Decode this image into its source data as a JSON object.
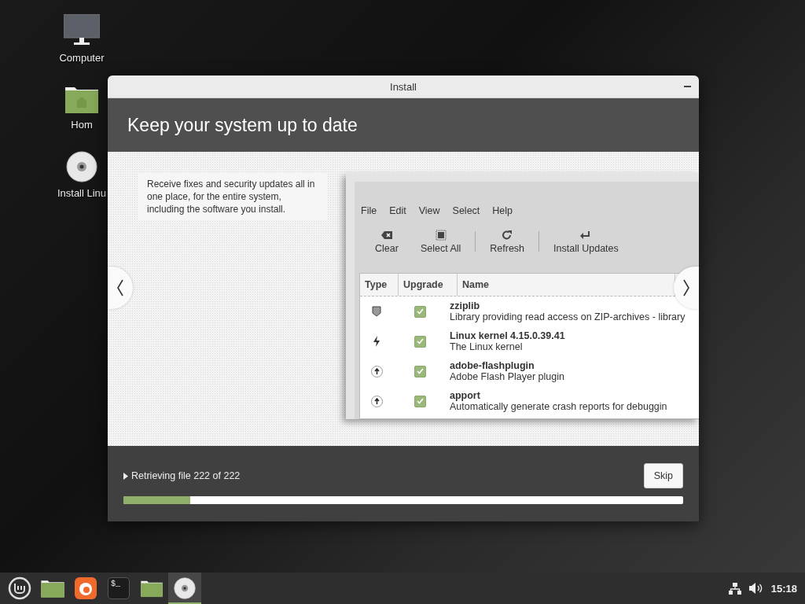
{
  "desktop_icons": [
    {
      "kind": "computer",
      "label": "Computer"
    },
    {
      "kind": "folder",
      "label": "Hom"
    },
    {
      "kind": "disc",
      "label": "Install Linu"
    }
  ],
  "window": {
    "title": "Install",
    "heading": "Keep your system up to date",
    "description": "Receive fixes and security updates all in one place, for the entire system, including the software you install.",
    "screenshot": {
      "menu": [
        "File",
        "Edit",
        "View",
        "Select",
        "Help"
      ],
      "toolbar": [
        {
          "kind": "clear",
          "label": "Clear"
        },
        {
          "kind": "select-all",
          "label": "Select All"
        },
        {
          "kind": "refresh",
          "label": "Refresh"
        },
        {
          "kind": "install",
          "label": "Install Updates"
        }
      ],
      "columns": [
        "Type",
        "Upgrade",
        "Name"
      ],
      "rows": [
        {
          "kind": "security",
          "checked": true,
          "name": "zziplib",
          "description": "Library providing read access on ZIP-archives - library"
        },
        {
          "kind": "kernel",
          "checked": true,
          "name": "Linux kernel 4.15.0.39.41",
          "description": "The Linux kernel"
        },
        {
          "kind": "upgrade",
          "checked": true,
          "name": "adobe-flashplugin",
          "description": "Adobe Flash Player plugin"
        },
        {
          "kind": "upgrade",
          "checked": true,
          "name": "apport",
          "description": "Automatically generate crash reports for debuggin"
        }
      ]
    },
    "status": "Retrieving file 222 of 222",
    "skip": "Skip",
    "progress": {
      "level": 0.12
    }
  },
  "taskbar": {
    "apps": [
      {
        "kind": "files",
        "selected": false
      },
      {
        "kind": "browser",
        "selected": false
      },
      {
        "kind": "terminal",
        "label": "$_",
        "selected": false
      },
      {
        "kind": "folder",
        "selected": false
      },
      {
        "kind": "disc",
        "selected": true
      }
    ],
    "clock": "15:18"
  }
}
